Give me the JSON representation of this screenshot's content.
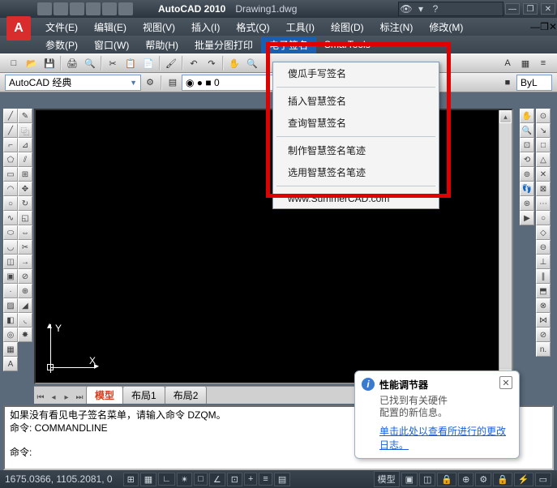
{
  "title": {
    "app": "AutoCAD 2010",
    "doc": "Drawing1.dwg"
  },
  "menubar1": {
    "file": "文件(E)",
    "edit": "编辑(E)",
    "view": "视图(V)",
    "insert": "插入(I)",
    "format": "格式(Q)",
    "tools": "工具(I)",
    "draw": "绘图(D)",
    "dimension": "标注(N)",
    "modify": "修改(M)"
  },
  "menubar2": {
    "parametric": "参数(P)",
    "window": "窗口(W)",
    "help": "帮助(H)",
    "batchprint": "批量分图打印",
    "esign": "电子签名",
    "smartools": "SmarTools"
  },
  "dropdown": {
    "items": [
      "傻瓜手写签名",
      "插入智慧签名",
      "查询智慧签名",
      "制作智慧签名笔迹",
      "选用智慧签名笔迹",
      "www.SummerCAD.com"
    ]
  },
  "workspace": {
    "combo": "AutoCAD 经典"
  },
  "layer": {
    "combo": "ByL"
  },
  "tabs": {
    "model": "模型",
    "layout1": "布局1",
    "layout2": "布局2"
  },
  "cmd": {
    "line1": "如果没有看见电子签名菜单，请输入命令 DZQM。",
    "line2": "命令: COMMANDLINE",
    "prompt": "命令:"
  },
  "status": {
    "coords": "1675.0366, 1105.2081, 0",
    "model": "模型"
  },
  "balloon": {
    "title": "性能调节器",
    "body1": "已找到有关硬件",
    "body2": "配置的新信息。",
    "link": "单击此处以查看所进行的更改日志。"
  },
  "ucs": {
    "y": "Y",
    "x": "X"
  }
}
